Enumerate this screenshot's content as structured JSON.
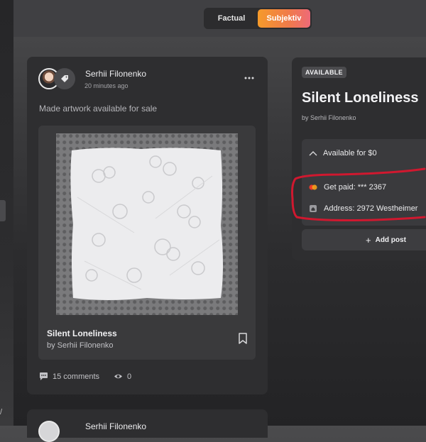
{
  "toggle": {
    "options": [
      "Factual",
      "Subjektiv"
    ],
    "active": "Subjektiv"
  },
  "post": {
    "author": "Serhii Filonenko",
    "time": "20 minutes ago",
    "text": "Made artwork available for sale",
    "artwork": {
      "title": "Silent Loneliness",
      "by": "by Serhii Filonenko"
    },
    "comments": "15 comments",
    "views": "0"
  },
  "next_post": {
    "author": "Serhii Filonenko"
  },
  "panel": {
    "badge": "AVAILABLE",
    "title": "Silent Loneliness",
    "by": "by Serhii Filonenko",
    "sale_label": "Available for $0",
    "get_paid": "Get paid: *** 2367",
    "address": "Address: 2972 Westheimer",
    "add_post": "Add post"
  },
  "colors": {
    "accent_start": "#f59a2a",
    "accent_end": "#ee6a78",
    "annotation": "#d0182f"
  },
  "icons": [
    "more-icon",
    "bookmark-icon",
    "comment-icon",
    "eye-icon",
    "chevron-up-icon",
    "mastercard-icon",
    "home-icon",
    "plus-icon"
  ]
}
